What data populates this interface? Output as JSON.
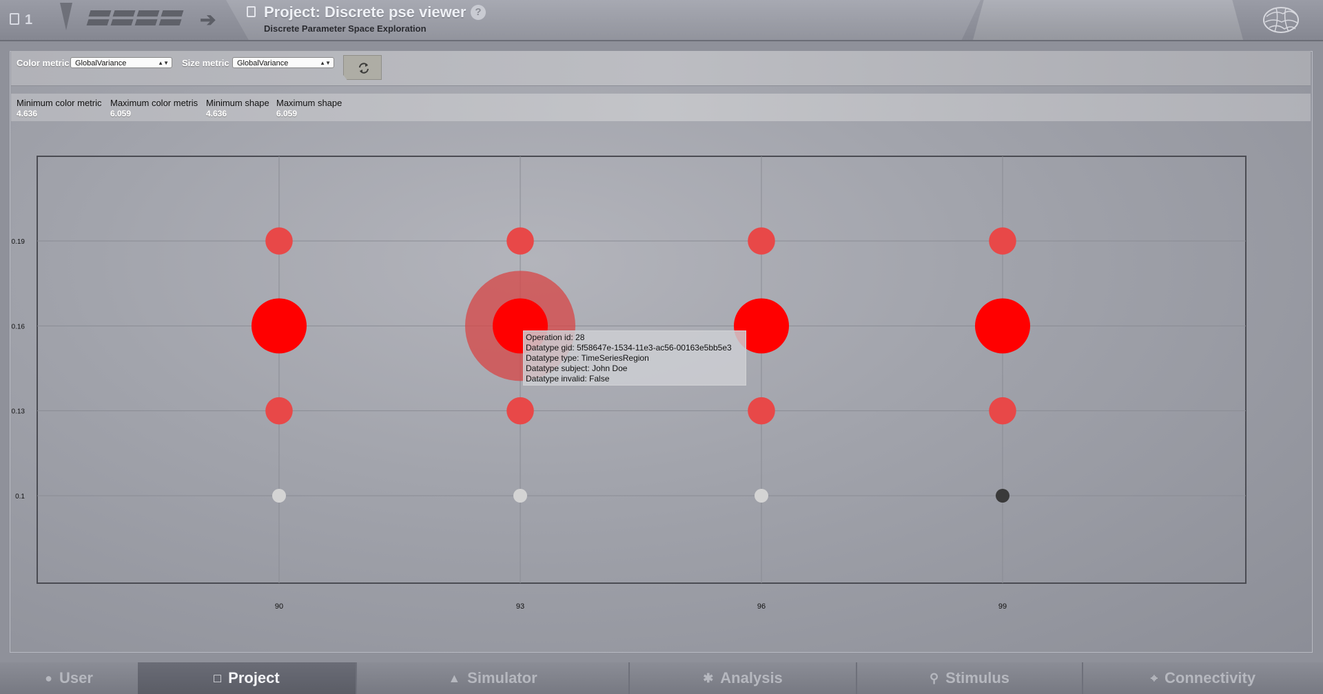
{
  "header": {
    "project_counter": "1",
    "title": "Project: Discrete pse viewer",
    "subtitle": "Discrete Parameter Space Exploration",
    "help_label": "?"
  },
  "controls": {
    "color_metric_label": "Color metric",
    "color_metric_value": "GlobalVariance",
    "size_metric_label": "Size metric",
    "size_metric_value": "GlobalVariance"
  },
  "stats": [
    {
      "label": "Minimum color metric",
      "value": "4.636"
    },
    {
      "label": "Maximum color metris",
      "value": "6.059"
    },
    {
      "label": "Minimum shape",
      "value": "4.636"
    },
    {
      "label": "Maximum shape",
      "value": "6.059"
    }
  ],
  "chart_data": {
    "type": "scatter",
    "x_ticks": [
      "90",
      "93",
      "96",
      "99"
    ],
    "y_ticks": [
      "0.19",
      "0.16",
      "0.13",
      "0.1"
    ],
    "grid": true,
    "points": [
      {
        "x": 90,
        "y": 0.19,
        "metric": 5.1,
        "color": "#e84848"
      },
      {
        "x": 93,
        "y": 0.19,
        "metric": 5.1,
        "color": "#e84848"
      },
      {
        "x": 96,
        "y": 0.19,
        "metric": 5.1,
        "color": "#e84848"
      },
      {
        "x": 99,
        "y": 0.19,
        "metric": 5.1,
        "color": "#e84848"
      },
      {
        "x": 90,
        "y": 0.16,
        "metric": 6.059,
        "color": "#ff0000"
      },
      {
        "x": 93,
        "y": 0.16,
        "metric": 6.059,
        "color": "#ff0000",
        "highlighted": true
      },
      {
        "x": 96,
        "y": 0.16,
        "metric": 6.059,
        "color": "#ff0000"
      },
      {
        "x": 99,
        "y": 0.16,
        "metric": 6.059,
        "color": "#ff0000"
      },
      {
        "x": 90,
        "y": 0.13,
        "metric": 5.1,
        "color": "#e84848"
      },
      {
        "x": 93,
        "y": 0.13,
        "metric": 5.1,
        "color": "#e84848"
      },
      {
        "x": 96,
        "y": 0.13,
        "metric": 5.1,
        "color": "#e84848"
      },
      {
        "x": 99,
        "y": 0.13,
        "metric": 5.1,
        "color": "#e84848"
      },
      {
        "x": 90,
        "y": 0.1,
        "metric": 4.636,
        "color": "#d4d4d4"
      },
      {
        "x": 93,
        "y": 0.1,
        "metric": 4.636,
        "color": "#d4d4d4"
      },
      {
        "x": 96,
        "y": 0.1,
        "metric": 4.636,
        "color": "#d4d4d4"
      },
      {
        "x": 99,
        "y": 0.1,
        "metric": 4.636,
        "color": "#3a3a3a"
      }
    ]
  },
  "tooltip": {
    "lines": [
      "Operation id: 28",
      "Datatype gid: 5f58647e-1534-11e3-ac56-00163e5bb5e3",
      "Datatype type: TimeSeriesRegion",
      "Datatype subject: John Doe",
      "Datatype invalid: False"
    ]
  },
  "tabs": [
    {
      "label": "User",
      "icon": "user-icon",
      "active": false
    },
    {
      "label": "Project",
      "icon": "document-icon",
      "active": true
    },
    {
      "label": "Simulator",
      "icon": "rocket-icon",
      "active": false
    },
    {
      "label": "Analysis",
      "icon": "gear-icon",
      "active": false
    },
    {
      "label": "Stimulus",
      "icon": "location-pin-icon",
      "active": false
    },
    {
      "label": "Connectivity",
      "icon": "connectivity-icon",
      "active": false
    }
  ]
}
